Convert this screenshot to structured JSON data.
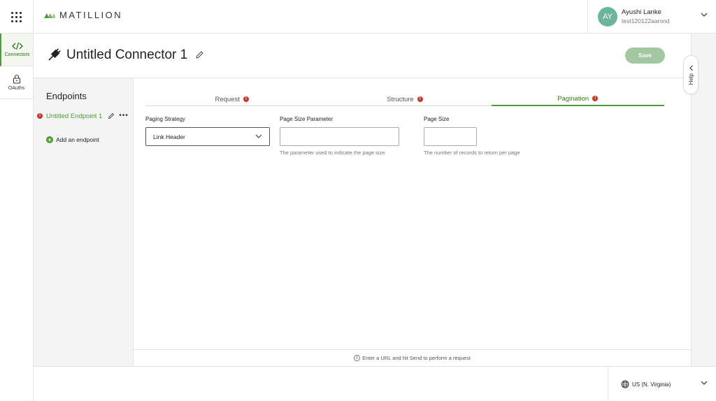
{
  "header": {
    "logo_text": "MATILLION",
    "user": {
      "initials": "AY",
      "name": "Ayushi Lanke",
      "org": "test120122aarond"
    }
  },
  "rail": {
    "items": [
      {
        "label": "Connectors",
        "icon": "code-icon",
        "active": true
      },
      {
        "label": "OAuths",
        "icon": "lock-icon",
        "active": false
      }
    ]
  },
  "title": {
    "text": "Untitled Connector 1",
    "save_label": "Save"
  },
  "endpoints": {
    "title": "Endpoints",
    "items": [
      {
        "name": "Untitled Endpoint 1",
        "has_error": true
      }
    ],
    "add_label": "Add an endpoint"
  },
  "tabs": [
    {
      "label": "Request",
      "has_error": true,
      "active": false
    },
    {
      "label": "Structure",
      "has_error": true,
      "active": false
    },
    {
      "label": "Pagination",
      "has_error": true,
      "active": true
    }
  ],
  "pagination": {
    "paging_strategy_label": "Paging Strategy",
    "paging_strategy_value": "Link Header",
    "page_size_param_label": "Page Size Parameter",
    "page_size_param_value": "",
    "page_size_param_hint": "The parameter used to indicate the page size",
    "page_size_label": "Page Size",
    "page_size_value": "",
    "page_size_hint": "The number of records to return per page"
  },
  "footer_msg": "Enter a URL and hit Send to perform a request",
  "help_label": "Help",
  "region": "US (N. Virginia)",
  "colors": {
    "brand_green": "#4f9a38",
    "error_red": "#c0392b",
    "save_disabled": "#a3c7a1",
    "avatar": "#6db59a"
  }
}
